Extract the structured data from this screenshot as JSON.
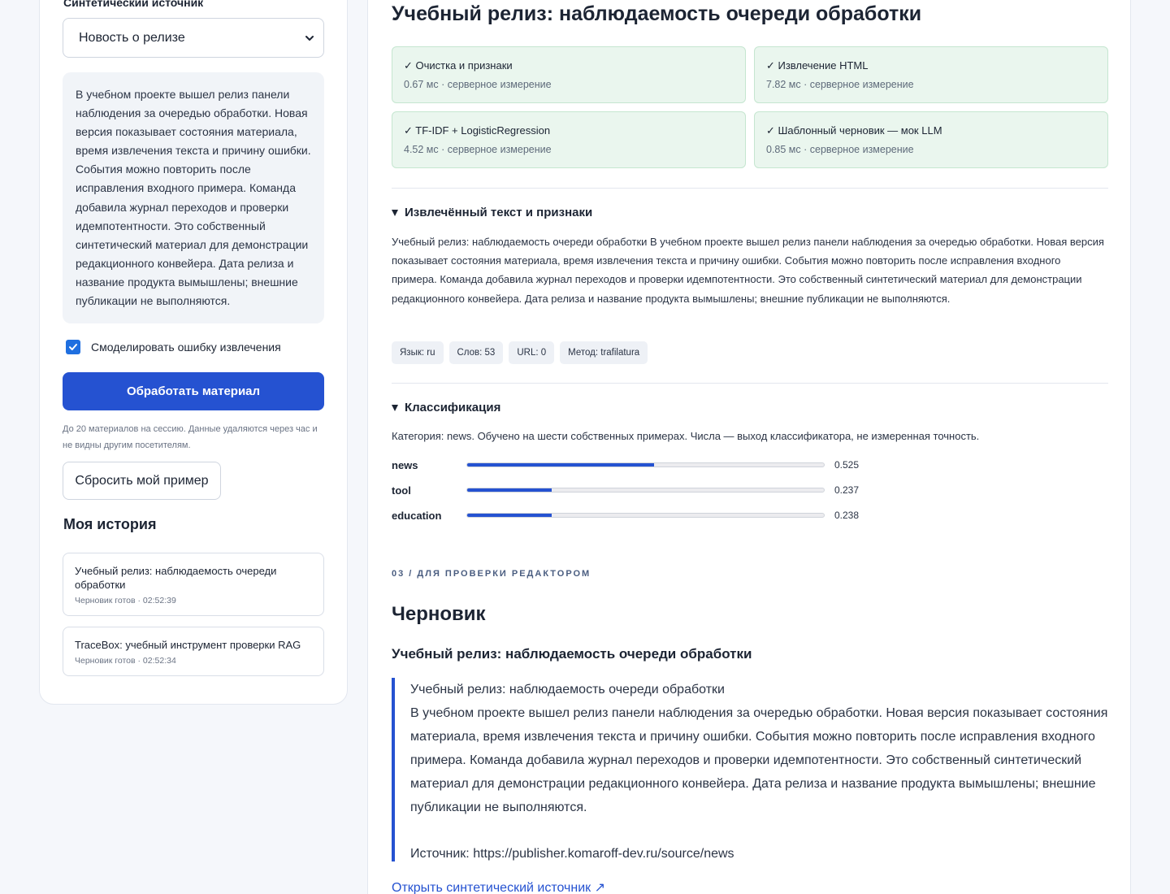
{
  "sidebar": {
    "source_label": "Синтетический источник",
    "source_select": "Новость о релизе",
    "source_text": "В учебном проекте вышел релиз панели наблюдения за очередью обработки. Новая версия показывает состояния материала, время извлечения текста и причину ошибки. События можно повторить после исправления входного примера. Команда добавила журнал переходов и проверки идемпотентности. Это собственный синтетический материал для демонстрации редакционного конвейера. Дата релиза и название продукта вымышлены; внешние публикации не выполняются.",
    "simulate_error_label": "Смоделировать ошибку извлечения",
    "simulate_error_checked": true,
    "process_button": "Обработать материал",
    "note": "До 20 материалов на сессию. Данные удаляются через час и не видны другим посетителям.",
    "reset_button": "Сбросить мой пример",
    "history_title": "Моя история",
    "history": [
      {
        "title": "Учебный релиз: наблюдаемость очереди обработки",
        "meta": "Черновик готов · 02:52:39"
      },
      {
        "title": "TraceBox: учебный инструмент проверки RAG",
        "meta": "Черновик готов · 02:52:34"
      }
    ]
  },
  "main": {
    "title": "Учебный релиз: наблюдаемость очереди обработки",
    "steps": [
      {
        "name": "✓ Очистка и признаки",
        "stat": "0.67 мс · серверное измерение"
      },
      {
        "name": "✓ Извлечение HTML",
        "stat": "7.82 мс · серверное измерение"
      },
      {
        "name": "✓ TF-IDF + LogisticRegression",
        "stat": "4.52 мс · серверное измерение"
      },
      {
        "name": "✓ Шаблонный черновик — мок LLM",
        "stat": "0.85 мс · серверное измерение"
      }
    ],
    "extract": {
      "heading": "Извлечённый текст и признаки",
      "text": "Учебный релиз: наблюдаемость очереди обработки В учебном проекте вышел релиз панели наблюдения за очередью обработки. Новая версия показывает состояния материала, время извлечения текста и причину ошибки. События можно повторить после исправления входного примера. Команда добавила журнал переходов и проверки идемпотентности. Это собственный синтетический материал для демонстрации редакционного конвейера. Дата релиза и название продукта вымышлены; внешние публикации не выполняются.",
      "tags": [
        "Язык: ru",
        "Слов: 53",
        "URL: 0",
        "Метод: trafilatura"
      ]
    },
    "classification": {
      "heading": "Классификация",
      "description": "Категория: news. Обучено на шести собственных примерах. Числа — выход классификатора, не измеренная точность.",
      "scores": [
        {
          "label": "news",
          "value": 0.525,
          "value_text": "0.525"
        },
        {
          "label": "tool",
          "value": 0.237,
          "value_text": "0.237"
        },
        {
          "label": "education",
          "value": 0.238,
          "value_text": "0.238"
        }
      ]
    },
    "draft": {
      "eyebrow": "03 / ДЛЯ ПРОВЕРКИ РЕДАКТОРОМ",
      "title": "Черновик",
      "subtitle": "Учебный релиз: наблюдаемость очереди обработки",
      "quote_title": "Учебный релиз: наблюдаемость очереди обработки",
      "quote_body": "В учебном проекте вышел релиз панели наблюдения за очередью обработки. Новая версия показывает состояния материала, время извлечения текста и причину ошибки. События можно повторить после исправления входного примера. Команда добавила журнал переходов и проверки идемпотентности. Это собственный синтетический материал для демонстрации редакционного конвейера. Дата релиза и название продукта вымышлены; внешние публикации не выполняются.",
      "quote_source": "Источник: https://publisher.komaroff-dev.ru/source/news",
      "link": "Открыть синтетический источник ↗"
    }
  },
  "colors": {
    "accent": "#2552d1",
    "success_bg": "#eaf6ee",
    "success_border": "#c5e6d0"
  }
}
